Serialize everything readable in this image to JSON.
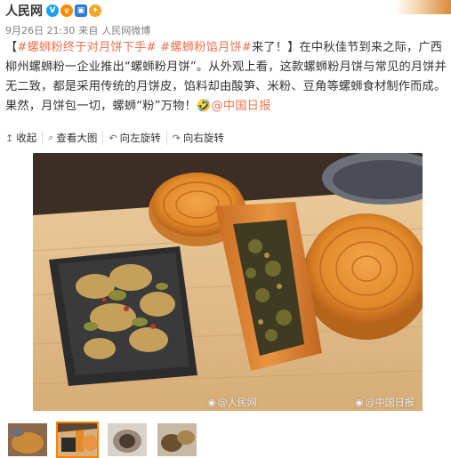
{
  "post": {
    "username": "人民网",
    "badges": [
      "verified-v-icon",
      "crown-icon",
      "membership-icon",
      "lightbulb-icon"
    ],
    "date": "9月26日 21:30",
    "source_prefix": "来自",
    "source": "人民网微博",
    "content": {
      "lead_bracket": "【",
      "hashtag1": "#螺蛳粉终于对月饼下手#",
      "hashtag2": "#螺蛳粉馅月饼#",
      "headline_tail": "来了！】在中秋佳节到来之际，广西柳州螺蛳粉一企业推出“螺蛳粉月饼”。从外观上看，这款螺蛳粉月饼与常见的月饼并无二致，都是采用传统的月饼皮，馅料却由酸笋、米粉、豆角等螺蛳食材制作而成。果然，月饼包一切，螺蛳“粉”万物！",
      "emoji": "🤣",
      "mention": "@中国日报"
    }
  },
  "toolbar": {
    "collapse": "收起",
    "view_large": "查看大图",
    "rotate_left": "向左旋转",
    "rotate_right": "向右旋转"
  },
  "photo": {
    "watermark_left": "@人民网",
    "watermark_right": "@中国日报"
  },
  "thumbnails": {
    "count": 4,
    "active_index": 1
  },
  "colors": {
    "link": "#eb7350",
    "active_thumb_border": "#ff8200",
    "meta_gray": "#808080"
  }
}
